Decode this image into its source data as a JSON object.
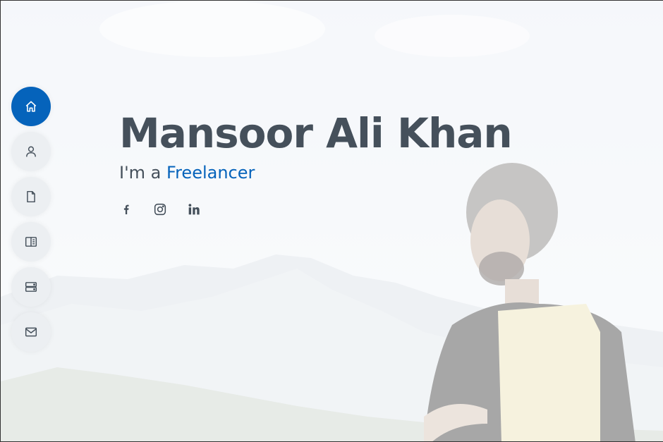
{
  "hero": {
    "name": "Mansoor Ali Khan",
    "tagline_prefix": "I'm a ",
    "tagline_typed": "Freelancer"
  },
  "nav": {
    "items": [
      {
        "icon": "home-icon",
        "active": true
      },
      {
        "icon": "person-icon",
        "active": false
      },
      {
        "icon": "file-icon",
        "active": false
      },
      {
        "icon": "book-icon",
        "active": false
      },
      {
        "icon": "server-icon",
        "active": false
      },
      {
        "icon": "envelope-icon",
        "active": false
      }
    ]
  },
  "social": [
    "facebook-icon",
    "instagram-icon",
    "linkedin-icon"
  ],
  "colors": {
    "accent": "#0563bb",
    "heading": "#45505b",
    "nav_bg": "#eceff2"
  }
}
